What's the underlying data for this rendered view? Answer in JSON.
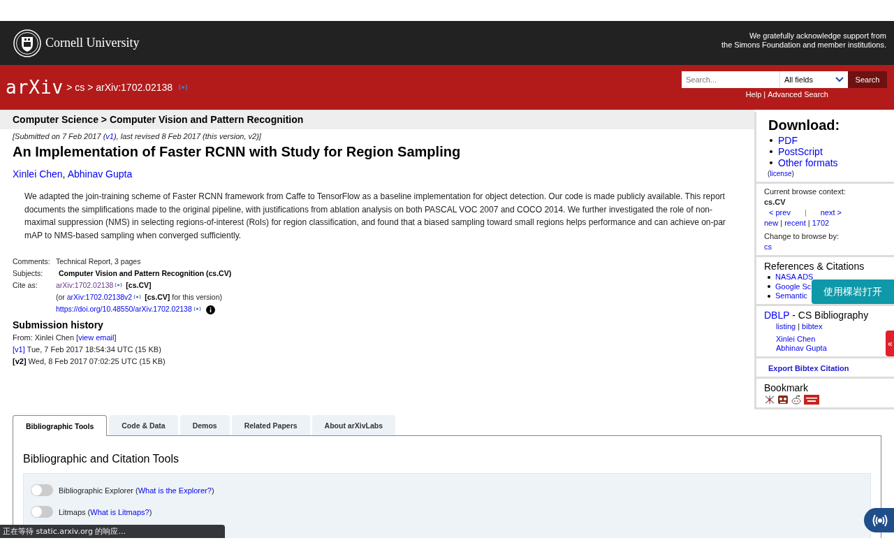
{
  "header": {
    "institution": "Cornell University",
    "support": [
      "We gratefully acknowledge support from",
      "the Simons Foundation and member institutions."
    ]
  },
  "nav": {
    "logo": "arXiv",
    "breadcrumb": "> cs > arXiv:1702.02138",
    "search": {
      "placeholder": "Search...",
      "field": "All fields",
      "button": "Search"
    },
    "help_links": [
      "Help",
      "Advanced Search"
    ],
    "separator": "|"
  },
  "subheader": "Computer Science > Computer Vision and Pattern Recognition",
  "dateline": [
    {
      "text": "[Submitted on 7 Feb 2017 (",
      "kind": "text"
    },
    {
      "text": "v1",
      "kind": "link"
    },
    {
      "text": "), last revised 8 Feb 2017 (this version, v2)]",
      "kind": "text"
    }
  ],
  "title": "An Implementation of Faster RCNN with Study for Region Sampling",
  "authors": [
    {
      "text": "Xinlei Chen",
      "kind": "link"
    },
    {
      "text": ", ",
      "kind": "text"
    },
    {
      "text": "Abhinav Gupta",
      "kind": "link"
    }
  ],
  "abstract": "We adapted the join-training scheme of Faster RCNN framework from Caffe to TensorFlow as a baseline implementation for object detection. Our code is made publicly available. This report documents the simplifications made to the original pipeline, with justifications from ablation analysis on both PASCAL VOC 2007 and COCO 2014. We further investigated the role of non-maximal suppression (NMS) in selecting regions-of-interest (RoIs) for region classification, and found that a biased sampling toward small regions helps performance and can achieve on-par mAP to NMS-based sampling when converged sufficiently.",
  "metadata": [
    {
      "label": "Comments:",
      "lines": [
        [
          {
            "text": "Technical Report, 3 pages",
            "kind": "text"
          }
        ]
      ]
    },
    {
      "label": "Subjects:",
      "lines": [
        [
          {
            "text": "Computer Vision and Pattern Recognition (cs.CV)",
            "kind": "bold"
          }
        ]
      ]
    },
    {
      "label": "Cite as:",
      "lines": [
        [
          {
            "text": "arXiv:1702.02138",
            "kind": "visited",
            "feed": true
          },
          {
            "text": "[cs.CV]",
            "kind": "bold"
          }
        ],
        [
          {
            "text": "(or ",
            "kind": "text"
          },
          {
            "text": "arXiv:1702.02138v2",
            "kind": "link",
            "feed": true
          },
          {
            "text": "[cs.CV]",
            "kind": "bold"
          },
          {
            "text": " for this version)",
            "kind": "text"
          }
        ],
        [
          {
            "text": "https://doi.org/10.48550/arXiv.1702.02138",
            "kind": "link",
            "feed": true,
            "info": true
          }
        ]
      ]
    }
  ],
  "history": {
    "heading": "Submission history",
    "lines": [
      [
        {
          "text": "From: Xinlei Chen [",
          "kind": "text"
        },
        {
          "text": "view email",
          "kind": "link"
        },
        {
          "text": "]",
          "kind": "text"
        }
      ],
      [
        {
          "text": "[v1]",
          "kind": "link"
        },
        {
          "text": " Tue, 7 Feb 2017 18:54:34 UTC (15 KB)",
          "kind": "text"
        }
      ],
      [
        {
          "text": "[v2]",
          "kind": "bold"
        },
        {
          "text": " Wed, 8 Feb 2017 07:02:25 UTC (15 KB)",
          "kind": "text"
        }
      ]
    ]
  },
  "sidebar": {
    "download": {
      "heading": "Download:",
      "links": [
        "PDF",
        "PostScript",
        "Other formats"
      ],
      "license": [
        {
          "text": "(",
          "kind": "text"
        },
        {
          "text": "license",
          "kind": "link"
        },
        {
          "text": ")",
          "kind": "text"
        }
      ]
    },
    "browse": {
      "label": "Current browse context:",
      "context": "cs.CV",
      "prevnext": [
        {
          "text": "< prev",
          "kind": "link"
        },
        {
          "text": "|",
          "kind": "text"
        },
        {
          "text": "next >",
          "kind": "link"
        }
      ],
      "lists": [
        {
          "text": "new",
          "kind": "link"
        },
        {
          "text": " | ",
          "kind": "text"
        },
        {
          "text": "recent",
          "kind": "link"
        },
        {
          "text": " | ",
          "kind": "text"
        },
        {
          "text": "1702",
          "kind": "link"
        }
      ],
      "change_label": "Change to browse by:",
      "change": "cs"
    },
    "references": {
      "heading": "References & Citations",
      "links": [
        "NASA ADS",
        "Google Sc",
        "Semantic"
      ]
    },
    "dblp": {
      "heading": [
        {
          "text": "DBLP",
          "kind": "link"
        },
        {
          "text": " - CS Bibliography",
          "kind": "text"
        }
      ],
      "links": [
        {
          "text": "listing",
          "kind": "link"
        },
        {
          "text": " | ",
          "kind": "text"
        },
        {
          "text": "bibtex",
          "kind": "link"
        }
      ],
      "authors": [
        "Xinlei Chen",
        "Abhinav Gupta"
      ]
    },
    "export": "Export Bibtex Citation",
    "bookmark": {
      "heading": "Bookmark"
    }
  },
  "tabs": [
    {
      "label": "Bibliographic Tools",
      "selected": true
    },
    {
      "label": "Code & Data",
      "selected": false
    },
    {
      "label": "Demos",
      "selected": false
    },
    {
      "label": "Related Papers",
      "selected": false
    },
    {
      "label": "About arXivLabs",
      "selected": false
    }
  ],
  "panel": {
    "heading": "Bibliographic and Citation Tools",
    "toggles": [
      {
        "on": false,
        "line": [
          {
            "text": "Bibliographic Explorer (",
            "kind": "text"
          },
          {
            "text": "What is the Explorer?",
            "kind": "link"
          },
          {
            "text": ")",
            "kind": "text"
          }
        ]
      },
      {
        "on": false,
        "line": [
          {
            "text": "Litmaps (",
            "kind": "text"
          },
          {
            "text": "What is Litmaps?",
            "kind": "link"
          },
          {
            "text": ")",
            "kind": "text"
          }
        ]
      }
    ]
  },
  "overlays": {
    "open_button": "使用棵岩打开",
    "side_tab": "«",
    "status": "正在等待 static.arxiv.org 的响应..."
  }
}
